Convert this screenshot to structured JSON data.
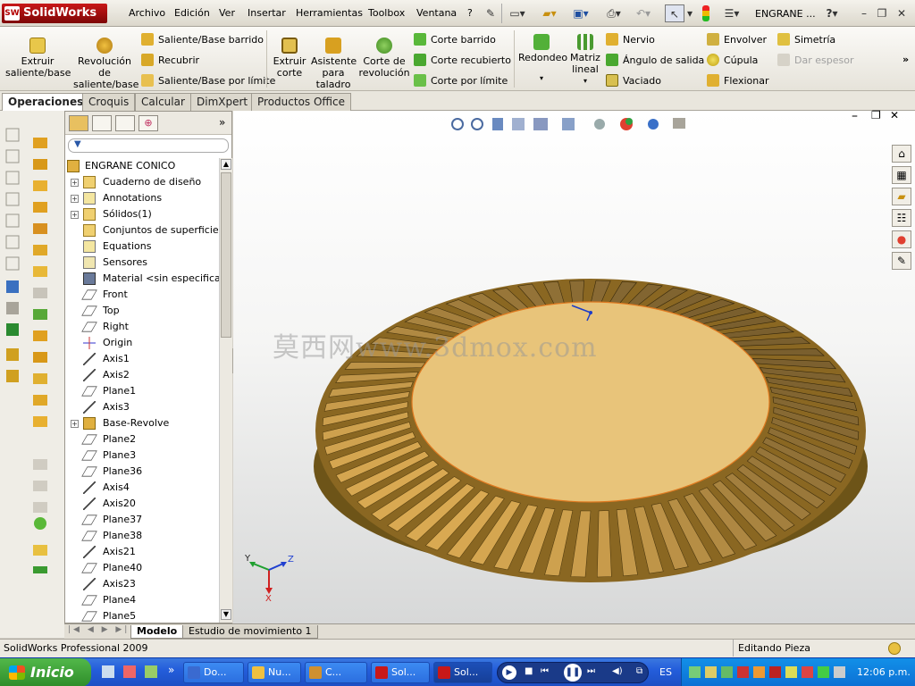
{
  "app": {
    "logo_text": "SolidWorks",
    "document_title": "ENGRANE ...",
    "help_glyph": "?",
    "menu": [
      "Archivo",
      "Edición",
      "Ver",
      "Insertar",
      "Herramientas",
      "Toolbox",
      "Ventana",
      "?"
    ]
  },
  "commands": {
    "big": [
      {
        "id": "extruir-saliente",
        "label": "Extruir saliente/base"
      },
      {
        "id": "revolucion-saliente",
        "label": "Revolución de saliente/base"
      },
      {
        "id": "extruir-corte",
        "label": "Extruir corte"
      },
      {
        "id": "asistente-taladro",
        "label": "Asistente para taladro"
      },
      {
        "id": "corte-revolucion",
        "label": "Corte de revolución"
      },
      {
        "id": "redondeo",
        "label": "Redondeo"
      },
      {
        "id": "matriz-lineal",
        "label": "Matriz lineal"
      }
    ],
    "col1": [
      "Saliente/Base barrido",
      "Recubrir",
      "Saliente/Base por límite"
    ],
    "col2": [
      "Corte barrido",
      "Corte recubierto",
      "Corte por límite"
    ],
    "col3": [
      "Nervio",
      "Ángulo de salida",
      "Vaciado"
    ],
    "col4": [
      "Envolver",
      "Cúpula",
      "Flexionar"
    ],
    "col5": [
      "Simetría",
      "Dar espesor"
    ]
  },
  "tabs": [
    "Operaciones",
    "Croquis",
    "Calcular",
    "DimXpert",
    "Productos Office"
  ],
  "tree": {
    "root": "ENGRANE CONICO",
    "items": [
      {
        "label": "Cuaderno de diseño",
        "expand": "+"
      },
      {
        "label": "Annotations",
        "expand": "+"
      },
      {
        "label": "Sólidos(1)",
        "expand": "+"
      },
      {
        "label": "Conjuntos de superficies",
        "expand": ""
      },
      {
        "label": "Equations",
        "expand": ""
      },
      {
        "label": "Sensores",
        "expand": ""
      },
      {
        "label": "Material <sin especificar>",
        "expand": ""
      },
      {
        "label": "Front",
        "expand": ""
      },
      {
        "label": "Top",
        "expand": ""
      },
      {
        "label": "Right",
        "expand": ""
      },
      {
        "label": "Origin",
        "expand": ""
      },
      {
        "label": "Axis1",
        "expand": ""
      },
      {
        "label": "Axis2",
        "expand": ""
      },
      {
        "label": "Plane1",
        "expand": ""
      },
      {
        "label": "Axis3",
        "expand": ""
      },
      {
        "label": "Base-Revolve",
        "expand": "+"
      },
      {
        "label": "Plane2",
        "expand": ""
      },
      {
        "label": "Plane3",
        "expand": ""
      },
      {
        "label": "Plane36",
        "expand": ""
      },
      {
        "label": "Axis4",
        "expand": ""
      },
      {
        "label": "Axis20",
        "expand": ""
      },
      {
        "label": "Plane37",
        "expand": ""
      },
      {
        "label": "Plane38",
        "expand": ""
      },
      {
        "label": "Axis21",
        "expand": ""
      },
      {
        "label": "Plane40",
        "expand": ""
      },
      {
        "label": "Axis23",
        "expand": ""
      },
      {
        "label": "Plane4",
        "expand": ""
      },
      {
        "label": "Plane5",
        "expand": ""
      }
    ]
  },
  "viewport": {
    "watermark": "莫西网www.3dmox.com",
    "triad": {
      "x": "X",
      "y": "Y",
      "z": "Z"
    }
  },
  "bottom_tabs": [
    "Modelo",
    "Estudio de movimiento 1"
  ],
  "status": {
    "left": "SolidWorks Professional 2009",
    "right": "Editando Pieza"
  },
  "taskbar": {
    "start_label": "Inicio",
    "tasks": [
      "Do...",
      "Nu...",
      "C...",
      "Sol...",
      "Sol..."
    ],
    "language": "ES",
    "clock": "12:06 p.m."
  },
  "colors": {
    "gear_face": "#e8c47a",
    "gear_teeth": "#d9a952",
    "gear_shadow": "#8a6722",
    "accent_red": "#c81818",
    "taskbar_blue": "#245edb"
  }
}
